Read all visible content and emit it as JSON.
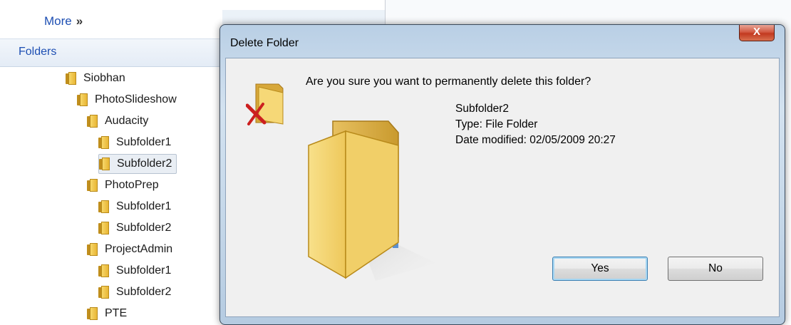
{
  "explorer": {
    "more_label": "More",
    "more_chevron": "»",
    "folders_label": "Folders",
    "tree": [
      {
        "label": "Siobhan",
        "level": 0,
        "selected": false
      },
      {
        "label": "PhotoSlideshow",
        "level": 1,
        "selected": false
      },
      {
        "label": "Audacity",
        "level": 2,
        "selected": false
      },
      {
        "label": "Subfolder1",
        "level": 3,
        "selected": false
      },
      {
        "label": "Subfolder2",
        "level": 3,
        "selected": true
      },
      {
        "label": "PhotoPrep",
        "level": 2,
        "selected": false
      },
      {
        "label": "Subfolder1",
        "level": 3,
        "selected": false
      },
      {
        "label": "Subfolder2",
        "level": 3,
        "selected": false
      },
      {
        "label": "ProjectAdmin",
        "level": 2,
        "selected": false
      },
      {
        "label": "Subfolder1",
        "level": 3,
        "selected": false
      },
      {
        "label": "Subfolder2",
        "level": 3,
        "selected": false
      },
      {
        "label": "PTE",
        "level": 2,
        "selected": false
      }
    ]
  },
  "dialog": {
    "title": "Delete Folder",
    "close_label": "X",
    "question": "Are you sure you want to permanently delete this folder?",
    "folder_name": "Subfolder2",
    "folder_type": "Type: File Folder",
    "date_modified": "Date modified: 02/05/2009 20:27",
    "yes_label": "Yes",
    "no_label": "No"
  },
  "colors": {
    "link_blue": "#1e4fb3",
    "folder_yellow": "#f4d26a",
    "close_red": "#c2391f",
    "delete_x_red": "#cc1f1f"
  },
  "icons": {
    "small": "folder-delete-icon",
    "large": "open-folder-icon",
    "tree": "folder-icon"
  }
}
